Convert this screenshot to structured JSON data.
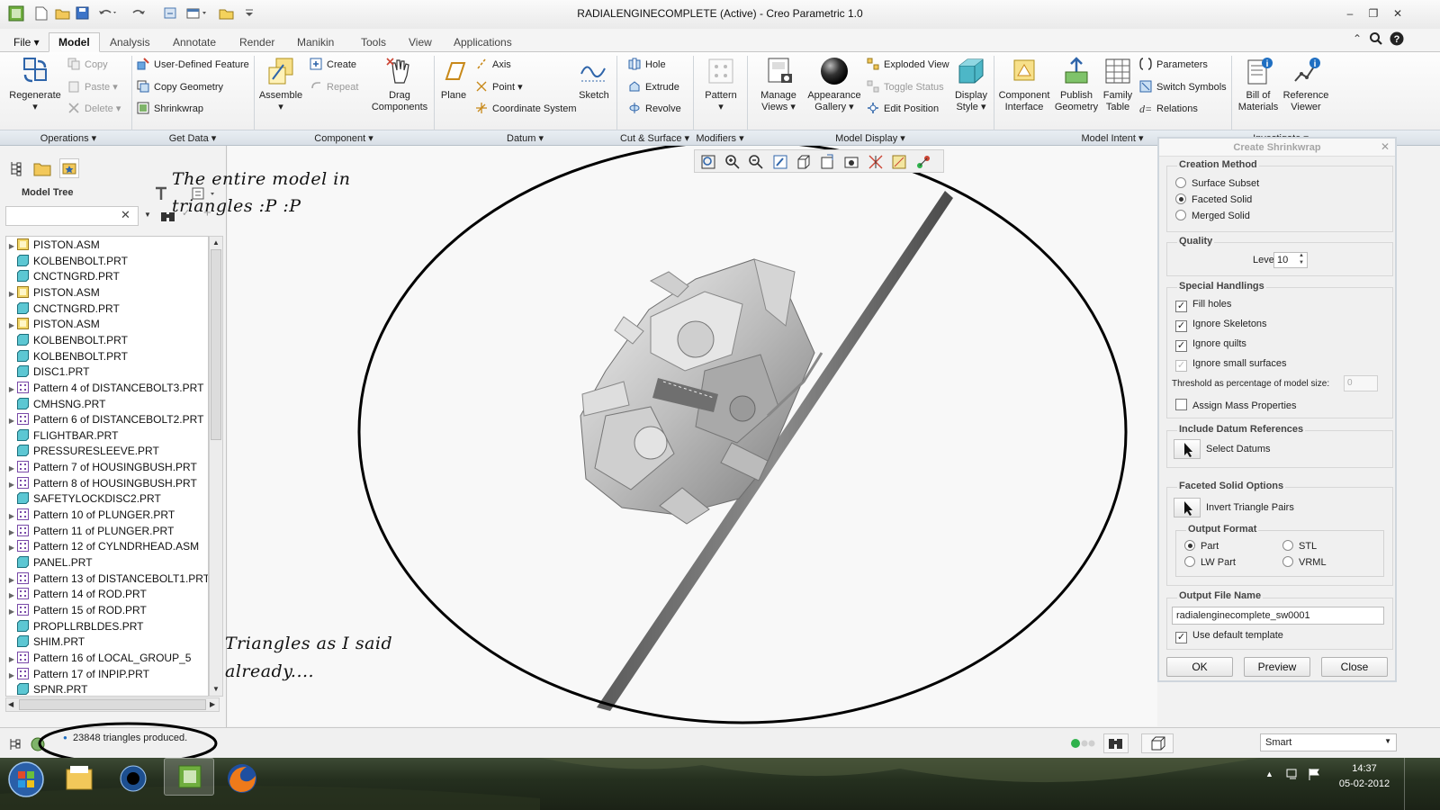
{
  "window": {
    "title": "RADIALENGINECOMPLETE (Active) - Creo Parametric 1.0"
  },
  "tabs": [
    "File",
    "Model",
    "Analysis",
    "Annotate",
    "Render",
    "Manikin",
    "Tools",
    "View",
    "Applications"
  ],
  "ribbon": {
    "regenerate": "Regenerate",
    "copy": "Copy",
    "paste": "Paste",
    "delete": "Delete",
    "user_defined_feature": "User-Defined Feature",
    "copy_geometry": "Copy Geometry",
    "shrinkwrap": "Shrinkwrap",
    "assemble": "Assemble",
    "create": "Create",
    "repeat": "Repeat",
    "drag_components_1": "Drag",
    "drag_components_2": "Components",
    "plane": "Plane",
    "axis": "Axis",
    "point": "Point",
    "coordinate_system": "Coordinate System",
    "sketch": "Sketch",
    "hole": "Hole",
    "extrude": "Extrude",
    "revolve": "Revolve",
    "pattern": "Pattern",
    "manage_views_1": "Manage",
    "manage_views_2": "Views",
    "appearance_gallery_1": "Appearance",
    "appearance_gallery_2": "Gallery",
    "exploded_view": "Exploded View",
    "toggle_status": "Toggle Status",
    "edit_position": "Edit Position",
    "display_style_1": "Display",
    "display_style_2": "Style",
    "component_interface_1": "Component",
    "component_interface_2": "Interface",
    "publish_geometry_1": "Publish",
    "publish_geometry_2": "Geometry",
    "family_table_1": "Family",
    "family_table_2": "Table",
    "parameters": "Parameters",
    "switch_symbols": "Switch Symbols",
    "relations": "Relations",
    "bill_of_materials_1": "Bill of",
    "bill_of_materials_2": "Materials",
    "reference_viewer_1": "Reference",
    "reference_viewer_2": "Viewer"
  },
  "groups": [
    "Operations",
    "Get Data",
    "Component",
    "Datum",
    "Cut & Surface",
    "Modifiers",
    "Model Display",
    "Model Intent",
    "Investigate"
  ],
  "model_tree": {
    "title": "Model Tree",
    "items": [
      {
        "label": "PISTON.ASM",
        "type": "asm",
        "exp": true
      },
      {
        "label": "KOLBENBOLT.PRT",
        "type": "prt",
        "exp": false
      },
      {
        "label": "CNCTNGRD.PRT",
        "type": "prt",
        "exp": false
      },
      {
        "label": "PISTON.ASM",
        "type": "asm",
        "exp": true
      },
      {
        "label": "CNCTNGRD.PRT",
        "type": "prt",
        "exp": false
      },
      {
        "label": "PISTON.ASM",
        "type": "asm",
        "exp": true
      },
      {
        "label": "KOLBENBOLT.PRT",
        "type": "prt",
        "exp": false
      },
      {
        "label": "KOLBENBOLT.PRT",
        "type": "prt",
        "exp": false
      },
      {
        "label": "DISC1.PRT",
        "type": "prt",
        "exp": false
      },
      {
        "label": "Pattern 4 of DISTANCEBOLT3.PRT",
        "type": "pat",
        "exp": true
      },
      {
        "label": "CMHSNG.PRT",
        "type": "prt",
        "exp": false
      },
      {
        "label": "Pattern 6 of DISTANCEBOLT2.PRT",
        "type": "pat",
        "exp": true
      },
      {
        "label": "FLIGHTBAR.PRT",
        "type": "prt",
        "exp": false
      },
      {
        "label": "PRESSURESLEEVE.PRT",
        "type": "prt",
        "exp": false
      },
      {
        "label": "Pattern 7 of HOUSINGBUSH.PRT",
        "type": "pat",
        "exp": true
      },
      {
        "label": "Pattern 8 of HOUSINGBUSH.PRT",
        "type": "pat",
        "exp": true
      },
      {
        "label": "SAFETYLOCKDISC2.PRT",
        "type": "prt",
        "exp": false
      },
      {
        "label": "Pattern 10 of PLUNGER.PRT",
        "type": "pat",
        "exp": true
      },
      {
        "label": "Pattern 11 of PLUNGER.PRT",
        "type": "pat",
        "exp": true
      },
      {
        "label": "Pattern 12 of CYLNDRHEAD.ASM",
        "type": "pat",
        "exp": true
      },
      {
        "label": "PANEL.PRT",
        "type": "prt",
        "exp": false
      },
      {
        "label": "Pattern 13 of DISTANCEBOLT1.PRT",
        "type": "pat",
        "exp": true
      },
      {
        "label": "Pattern 14 of ROD.PRT",
        "type": "pat",
        "exp": true
      },
      {
        "label": "Pattern 15 of ROD.PRT",
        "type": "pat",
        "exp": true
      },
      {
        "label": "PROPLLRBLDES.PRT",
        "type": "prt",
        "exp": false
      },
      {
        "label": "SHIM.PRT",
        "type": "prt",
        "exp": false
      },
      {
        "label": "Pattern 16 of LOCAL_GROUP_5",
        "type": "pat",
        "exp": true
      },
      {
        "label": "Pattern 17 of INPIP.PRT",
        "type": "pat",
        "exp": true
      },
      {
        "label": "SPNR.PRT",
        "type": "prt",
        "exp": false
      }
    ]
  },
  "annotations": {
    "note1_line1": "The entire model in",
    "note1_line2": "triangles  :P :P",
    "note2_line1": "Triangles as I said",
    "note2_line2": "already...."
  },
  "dialog": {
    "title": "Create Shrinkwrap",
    "creation_method": "Creation Method",
    "methods": [
      "Surface Subset",
      "Faceted Solid",
      "Merged Solid"
    ],
    "selected_method": 1,
    "quality": "Quality",
    "level_label": "Level:",
    "level_value": "10",
    "special_handlings": "Special Handlings",
    "fill_holes": "Fill holes",
    "ignore_skeletons": "Ignore Skeletons",
    "ignore_quilts": "Ignore quilts",
    "ignore_small_surfaces": "Ignore small surfaces",
    "threshold_label": "Threshold as percentage of model size:",
    "threshold_value": "0",
    "assign_mass": "Assign Mass Properties",
    "include_datum": "Include Datum References",
    "select_datums": "Select Datums",
    "faceted_options": "Faceted Solid Options",
    "invert_triangle_pairs": "Invert Triangle Pairs",
    "output_format": "Output Format",
    "format_part": "Part",
    "format_stl": "STL",
    "format_lw_part": "LW Part",
    "format_vrml": "VRML",
    "output_file_name": "Output File Name",
    "file_name_value": "radialenginecomplete_sw0001",
    "use_default_template": "Use default template",
    "ok": "OK",
    "preview": "Preview",
    "close": "Close"
  },
  "status": {
    "message": "23848 triangles produced.",
    "filter": "Smart"
  },
  "taskbar": {
    "time": "14:37",
    "date": "05-02-2012"
  },
  "colors": {
    "accent": "#1f6fc2",
    "status_green": "#2fb24c",
    "ribbon_group_bg": "#dfe5eb"
  }
}
